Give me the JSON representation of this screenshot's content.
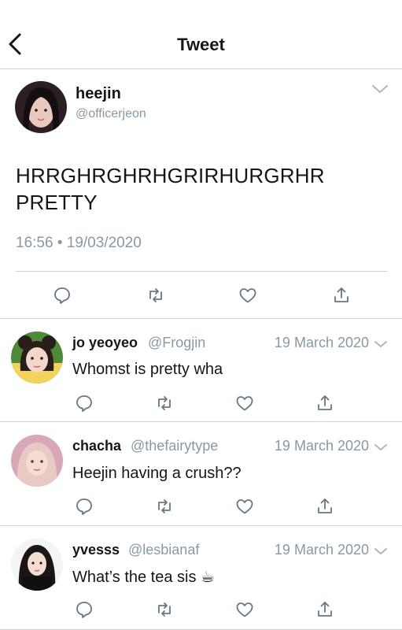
{
  "header": {
    "title": "Tweet"
  },
  "main_tweet": {
    "name": "heejin",
    "handle": "@officerjeon",
    "text_line1": "HRRGHRGHRHGRIRHURGRHR",
    "text_line2": "PRETTY",
    "meta": "16:56 • 19/03/2020"
  },
  "replies": [
    {
      "name": "jo yeoyeo",
      "handle": "@Frogjin",
      "date": "19 March 2020",
      "text": "Whomst is pretty wha"
    },
    {
      "name": "chacha",
      "handle": "@thefairytype",
      "date": "19 March 2020",
      "text": "Heejin having a crush??"
    },
    {
      "name": "yvesss",
      "handle": "@lesbianaf",
      "date": "19 March 2020",
      "text": "What’s the tea sis ☕"
    }
  ],
  "colors": {
    "text": "#14171a",
    "muted": "#8899a6",
    "divider": "#cfd3d6",
    "icon": "#657786"
  },
  "icons": [
    "back-arrow-icon",
    "chevron-down-icon",
    "reply-icon",
    "retweet-icon",
    "like-icon",
    "share-icon"
  ]
}
